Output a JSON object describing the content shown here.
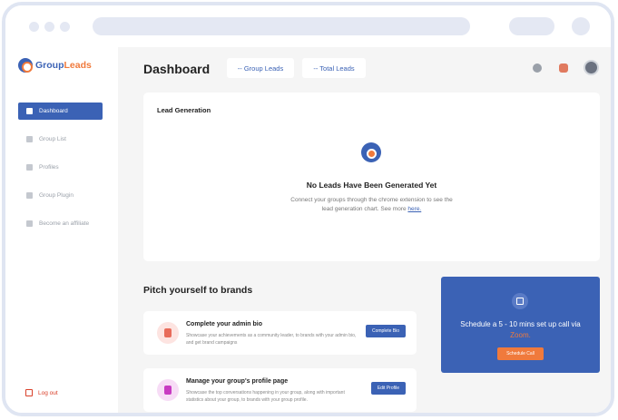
{
  "browser": {
    "window_dots": 3
  },
  "sidebar": {
    "logo": {
      "name_part1": "Group",
      "name_part2": "Leads"
    },
    "items": [
      {
        "label": "Dashboard",
        "icon": "dashboard-icon",
        "active": true
      },
      {
        "label": "Group List",
        "icon": "group-list-icon",
        "active": false
      },
      {
        "label": "Profiles",
        "icon": "profiles-icon",
        "active": false
      },
      {
        "label": "Group Plugin",
        "icon": "plugin-icon",
        "active": false
      },
      {
        "label": "Become an affiliate",
        "icon": "affiliate-icon",
        "active": false
      }
    ],
    "logout_label": "Log out"
  },
  "header": {
    "title": "Dashboard",
    "group_leads_label": "-- Group Leads",
    "total_leads_label": "-- Total Leads",
    "icons": [
      "help-icon",
      "notification-icon",
      "avatar"
    ]
  },
  "lead_generation": {
    "title": "Lead Generation",
    "empty_heading": "No Leads Have Been Generated Yet",
    "empty_desc": "Connect your groups through the chrome extension to see the lead generation chart. See more",
    "link_text": "here."
  },
  "pitch": {
    "title": "Pitch yourself to brands",
    "tasks": [
      {
        "title": "Complete your admin bio",
        "desc": "Showcase your achievements as a community leader, to brands with your admin bio, and get brand campaigns",
        "button": "Complete Bio"
      },
      {
        "title": "Manage your group's profile page",
        "desc": "Showcase the top conversations happening in your group, along with important statistics about your group, to brands with your group profile.",
        "button": "Edit Profile"
      }
    ]
  },
  "zoom": {
    "text": "Schedule a 5 - 10 mins set up call via",
    "zoom_word": "Zoom",
    "period": ".",
    "button": "Schedule Call"
  },
  "colors": {
    "brand": "#3b62b5",
    "accent": "#f07a3c",
    "logout": "#d9402a"
  }
}
